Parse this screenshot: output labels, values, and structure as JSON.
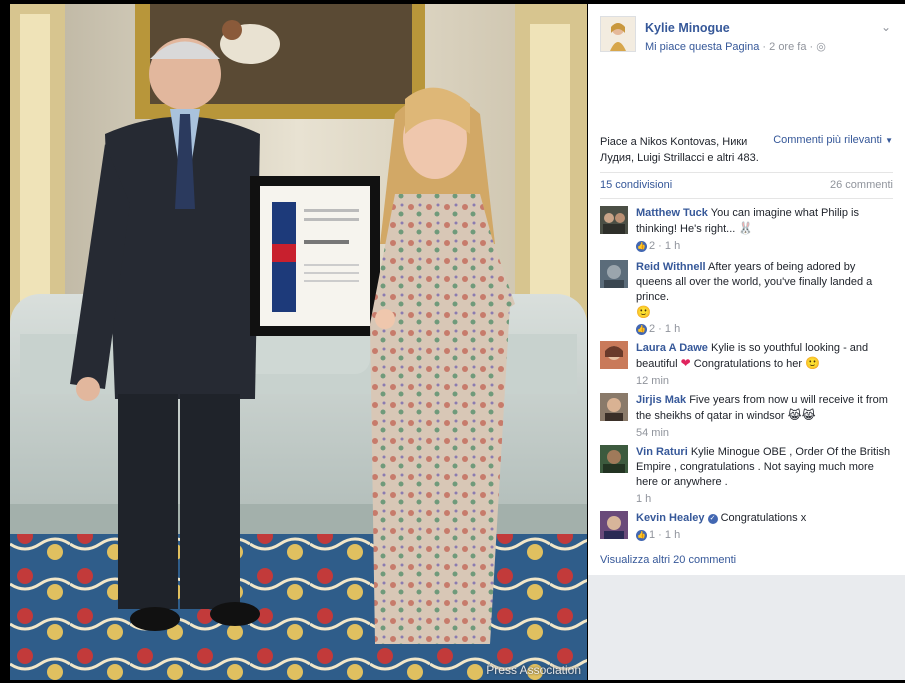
{
  "photo": {
    "credit": "Press Association"
  },
  "post": {
    "page_name": "Kylie Minogue",
    "like_page": "Mi piace questa Pagina",
    "time": "2 ore fa",
    "separator": " · ",
    "privacy_icon": "globe-icon",
    "menu_icon": "chevron-down-icon"
  },
  "reactions": {
    "likes_text": "Piace a Nikos Kontovas, Ники Лудия, Luigi Strillacci e altri 483.",
    "order_label": "Commenti più rilevanti",
    "shares": "15 condivisioni",
    "comments_count": "26 commenti"
  },
  "comments": [
    {
      "author": "Matthew Tuck",
      "text": "You can imagine what Philip is thinking! He's right...",
      "emoji": "🐰",
      "likes": "2",
      "time": "1 h"
    },
    {
      "author": "Reid Withnell",
      "text": "After years of being adored by queens all over the world, you've finally landed a prince.",
      "emoji": "🙂",
      "likes": "2",
      "time": "1 h"
    },
    {
      "author": "Laura A Dawe",
      "text": "Kylie is so youthful looking - and beautiful",
      "text2": "Congratulations to her",
      "time": "12 min"
    },
    {
      "author": "Jirjis Mak",
      "text": "Five years from now u will receive it from the sheikhs of qatar in windsor",
      "emoji": "😹😹",
      "time": "54 min"
    },
    {
      "author": "Vin Raturi",
      "text": "Kylie Minogue OBE , Order Of the British Empire , congratulations . Not saying much more here or anywhere .",
      "time": "1 h"
    },
    {
      "author": "Kevin Healey",
      "text": "Congratulations x",
      "likes": "1",
      "time": "1 h"
    }
  ],
  "more_comments": "Visualizza altri 20 commenti",
  "colors": {
    "link": "#365899",
    "meta": "#90949c",
    "like": "#4267b2",
    "panel_bg": "#e9ebee"
  }
}
